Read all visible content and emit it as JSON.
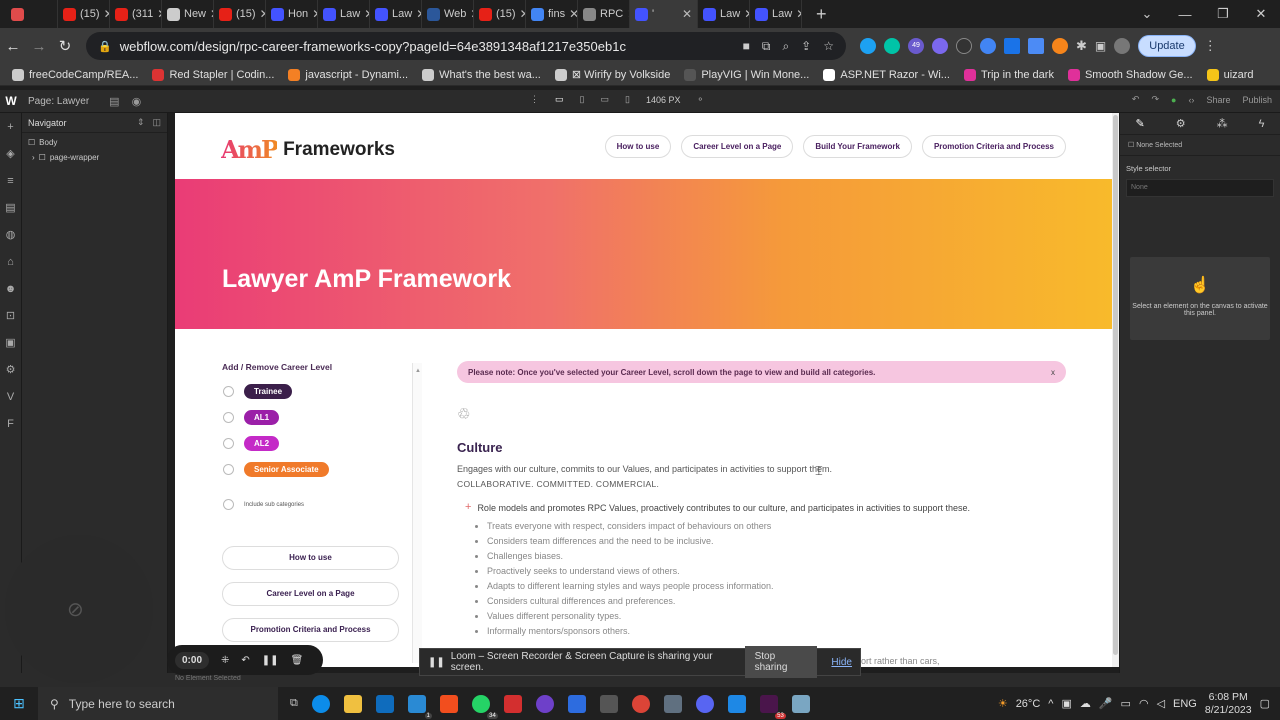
{
  "browser": {
    "tabs": [
      {
        "label": "",
        "icon": "record-icon",
        "color": "#e04b4b"
      },
      {
        "label": "(15)",
        "icon": "youtube-icon",
        "color": "#e62117"
      },
      {
        "label": "(311",
        "icon": "youtube-icon",
        "color": "#e62117"
      },
      {
        "label": "New",
        "icon": "github-icon",
        "color": "#cccccc"
      },
      {
        "label": "(15)",
        "icon": "youtube-icon",
        "color": "#e62117"
      },
      {
        "label": "Hon",
        "icon": "webflow-icon",
        "color": "#4353ff"
      },
      {
        "label": "Law",
        "icon": "webflow-icon",
        "color": "#4353ff"
      },
      {
        "label": "Law",
        "icon": "webflow-icon",
        "color": "#4353ff"
      },
      {
        "label": "Web",
        "icon": "word-icon",
        "color": "#2b579a"
      },
      {
        "label": "(15)",
        "icon": "youtube-icon",
        "color": "#e62117"
      },
      {
        "label": "fins",
        "icon": "google-icon",
        "color": "#4285f4"
      },
      {
        "label": "RPC",
        "icon": "page-icon",
        "color": "#888888"
      },
      {
        "label": "'",
        "icon": "webflow-icon",
        "color": "#4353ff"
      },
      {
        "label": "Law",
        "icon": "webflow-icon",
        "color": "#4353ff"
      },
      {
        "label": "Law",
        "icon": "webflow-icon",
        "color": "#4353ff"
      }
    ],
    "url": "webflow.com/design/rpc-career-frameworks-copy?pageId=64e3891348af1217e350eb1c",
    "update_label": "Update",
    "ext_badge": "49",
    "bookmarks": [
      {
        "label": "freeCodeCamp/REA...",
        "color": "#cccccc"
      },
      {
        "label": "Red Stapler | Codin...",
        "color": "#d33"
      },
      {
        "label": "javascript - Dynami...",
        "color": "#f48024"
      },
      {
        "label": "What's the best wa...",
        "color": "#cccccc"
      },
      {
        "label": "⊠ Wirify by Volkside",
        "color": "#cccccc"
      },
      {
        "label": "PlayVIG | Win Mone...",
        "color": "#555555"
      },
      {
        "label": "ASP.NET Razor - Wi...",
        "color": "#ffffff"
      },
      {
        "label": "Trip in the dark",
        "color": "#e0309a"
      },
      {
        "label": "Smooth Shadow Ge...",
        "color": "#e0309a"
      },
      {
        "label": "uizard",
        "color": "#f5c518"
      }
    ]
  },
  "webflow": {
    "logo": "W",
    "page_label": "Page: Lawyer",
    "canvas_width": "1406 PX",
    "share": "Share",
    "publish": "Publish",
    "navigator_title": "Navigator",
    "tree": [
      "Body",
      "page-wrapper"
    ],
    "none_selected": "None Selected",
    "style_selector": "Style selector",
    "style_placeholder": "None",
    "select_hint": "Select an element on the canvas to activate this panel.",
    "status": "No Element Selected"
  },
  "site": {
    "logo_mark": "AmP",
    "logo_word": "Frameworks",
    "nav": [
      "How to use",
      "Career Level on a Page",
      "Build Your Framework",
      "Promotion Criteria and Process"
    ],
    "hero_title": "Lawyer AmP Framework",
    "career_heading": "Add / Remove Career Level",
    "levels": [
      {
        "label": "Trainee",
        "color": "#3b1f4a"
      },
      {
        "label": "AL1",
        "color": "#9b1fa8"
      },
      {
        "label": "AL2",
        "color": "#c42ac7"
      },
      {
        "label": "Senior Associate",
        "color": "#f07a2a"
      }
    ],
    "subcategories": "Include sub categories",
    "side_buttons": [
      "How to use",
      "Career Level on a Page",
      "Promotion Criteria and Process"
    ],
    "notice": "Please note: Once you've selected your Career Level, scroll down the page to view and build all categories.",
    "notice_close": "x",
    "culture_title": "Culture",
    "culture_desc": "Engages with our culture, commits to our Values, and participates in activities to support them.",
    "culture_values": "COLLABORATIVE.  COMMITTED.  COMMERCIAL.",
    "role_model": "Role models and promotes RPC Values, proactively contributes to our culture, and participates in activities to support these.",
    "bullets": [
      "Treats everyone with respect, considers impact of behaviours on others",
      "Considers team differences and the need to be inclusive.",
      "Challenges biases.",
      "Proactively seeks to understand views of others.",
      "Adapts to different learning styles and ways people process information.",
      "Considers cultural differences and preferences.",
      "Values different personality types.",
      "Informally mentors/sponsors others."
    ],
    "trail_text": "port rather than cars,"
  },
  "loom": {
    "time": "0:00",
    "sharing_text": "Loom – Screen Recorder & Screen Capture is sharing your screen.",
    "stop": "Stop sharing",
    "hide": "Hide"
  },
  "taskbar": {
    "search_placeholder": "Type here to search",
    "weather": "26°C",
    "lang": "ENG",
    "time": "6:08 PM",
    "date": "8/21/2023",
    "badges": {
      "whatsapp": "34",
      "vscode": "1",
      "slack": "53"
    }
  }
}
